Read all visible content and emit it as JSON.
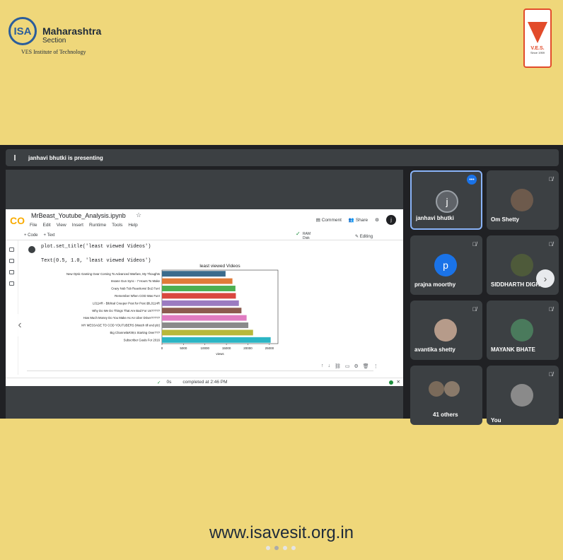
{
  "branding": {
    "org": "ISA",
    "section_name": "Maharashtra",
    "section_sub": "Section",
    "institute": "VES Institute of Technology",
    "ves_text": "V.E.S.",
    "ves_since": "Since 1959"
  },
  "meet": {
    "presenting_text": "janhavi bhutki is presenting"
  },
  "colab": {
    "logo": "CO",
    "notebook_title": "MrBeast_Youtube_Analysis.ipynb",
    "menu": [
      "File",
      "Edit",
      "View",
      "Insert",
      "Runtime",
      "Tools",
      "Help"
    ],
    "comment_label": "Comment",
    "share_label": "Share",
    "user_initial": "j",
    "add_code": "+ Code",
    "add_text": "+ Text",
    "ram_label": "RAM",
    "disk_label": "Disk",
    "editing_label": "Editing",
    "code_line_1": "plot.set_title('least viewed Videos')",
    "output_line": "Text(0.5, 1.0, 'least viewed Videos')",
    "status_time": "0s",
    "status_text": "completed at 2:46 PM"
  },
  "chart_data": {
    "type": "bar",
    "orientation": "horizontal",
    "title": "least viewed Videos",
    "xlabel": "views",
    "ylabel": "",
    "xlim": [
      0,
      27000
    ],
    "xticks": [
      0,
      5000,
      10000,
      15000,
      20000,
      25000
    ],
    "categories": [
      "New Optic Gaming Gear Coming To Advanced Warfare, My Thoughts",
      "Insane Gun Sync - 7 Hours To Make",
      "Crazy Nub Tub Reactions! Bo2 Fun!",
      "Remember When COD Was Fun!",
      "L0114R - Biblical Creeper Post for Post @L0114R",
      "Why Do We Do Things That Are Bad For Us?????",
      "How Much Money Do You Make As An Uber Driver?????",
      "MY MESSAGE TO COD YOUTUBERS (Watch till end plz)",
      "Big Channel&#39;s Starting Over???",
      "Subscriber Goals For 2016"
    ],
    "values": [
      14800,
      16400,
      17100,
      17200,
      17900,
      18500,
      19700,
      20100,
      21200,
      25300
    ],
    "colors": [
      "#3b6b8c",
      "#e07b39",
      "#4caf50",
      "#d9473f",
      "#9b7bc1",
      "#8c5a4f",
      "#e07bc1",
      "#8a8a8a",
      "#b8b83a",
      "#2bb5c4"
    ]
  },
  "participants": [
    {
      "name": "janhavi bhutki",
      "initial": "j",
      "avatar_color": "#5f6368",
      "muted": false,
      "active": true
    },
    {
      "name": "Om Shetty",
      "initial": "",
      "avatar_color": "#6d5a4c",
      "muted": true,
      "active": false
    },
    {
      "name": "prajna moorthy",
      "initial": "p",
      "avatar_color": "#1a73e8",
      "muted": true,
      "active": false
    },
    {
      "name": "SIDDHARTH DIGHE",
      "initial": "",
      "avatar_color": "#4e5a3a",
      "muted": true,
      "active": false
    },
    {
      "name": "avantika shetty",
      "initial": "",
      "avatar_color": "#b69b8a",
      "muted": true,
      "active": false
    },
    {
      "name": "MAYANK BHATE",
      "initial": "",
      "avatar_color": "#4a7a5c",
      "muted": true,
      "active": false
    },
    {
      "name": "41 others",
      "initial": "",
      "avatar_color": "#7a6a5a",
      "muted": false,
      "active": false
    },
    {
      "name": "You",
      "initial": "",
      "avatar_color": "#8a8a8a",
      "muted": true,
      "active": false
    }
  ],
  "footer": {
    "url": "www.isavesit.org.in"
  }
}
